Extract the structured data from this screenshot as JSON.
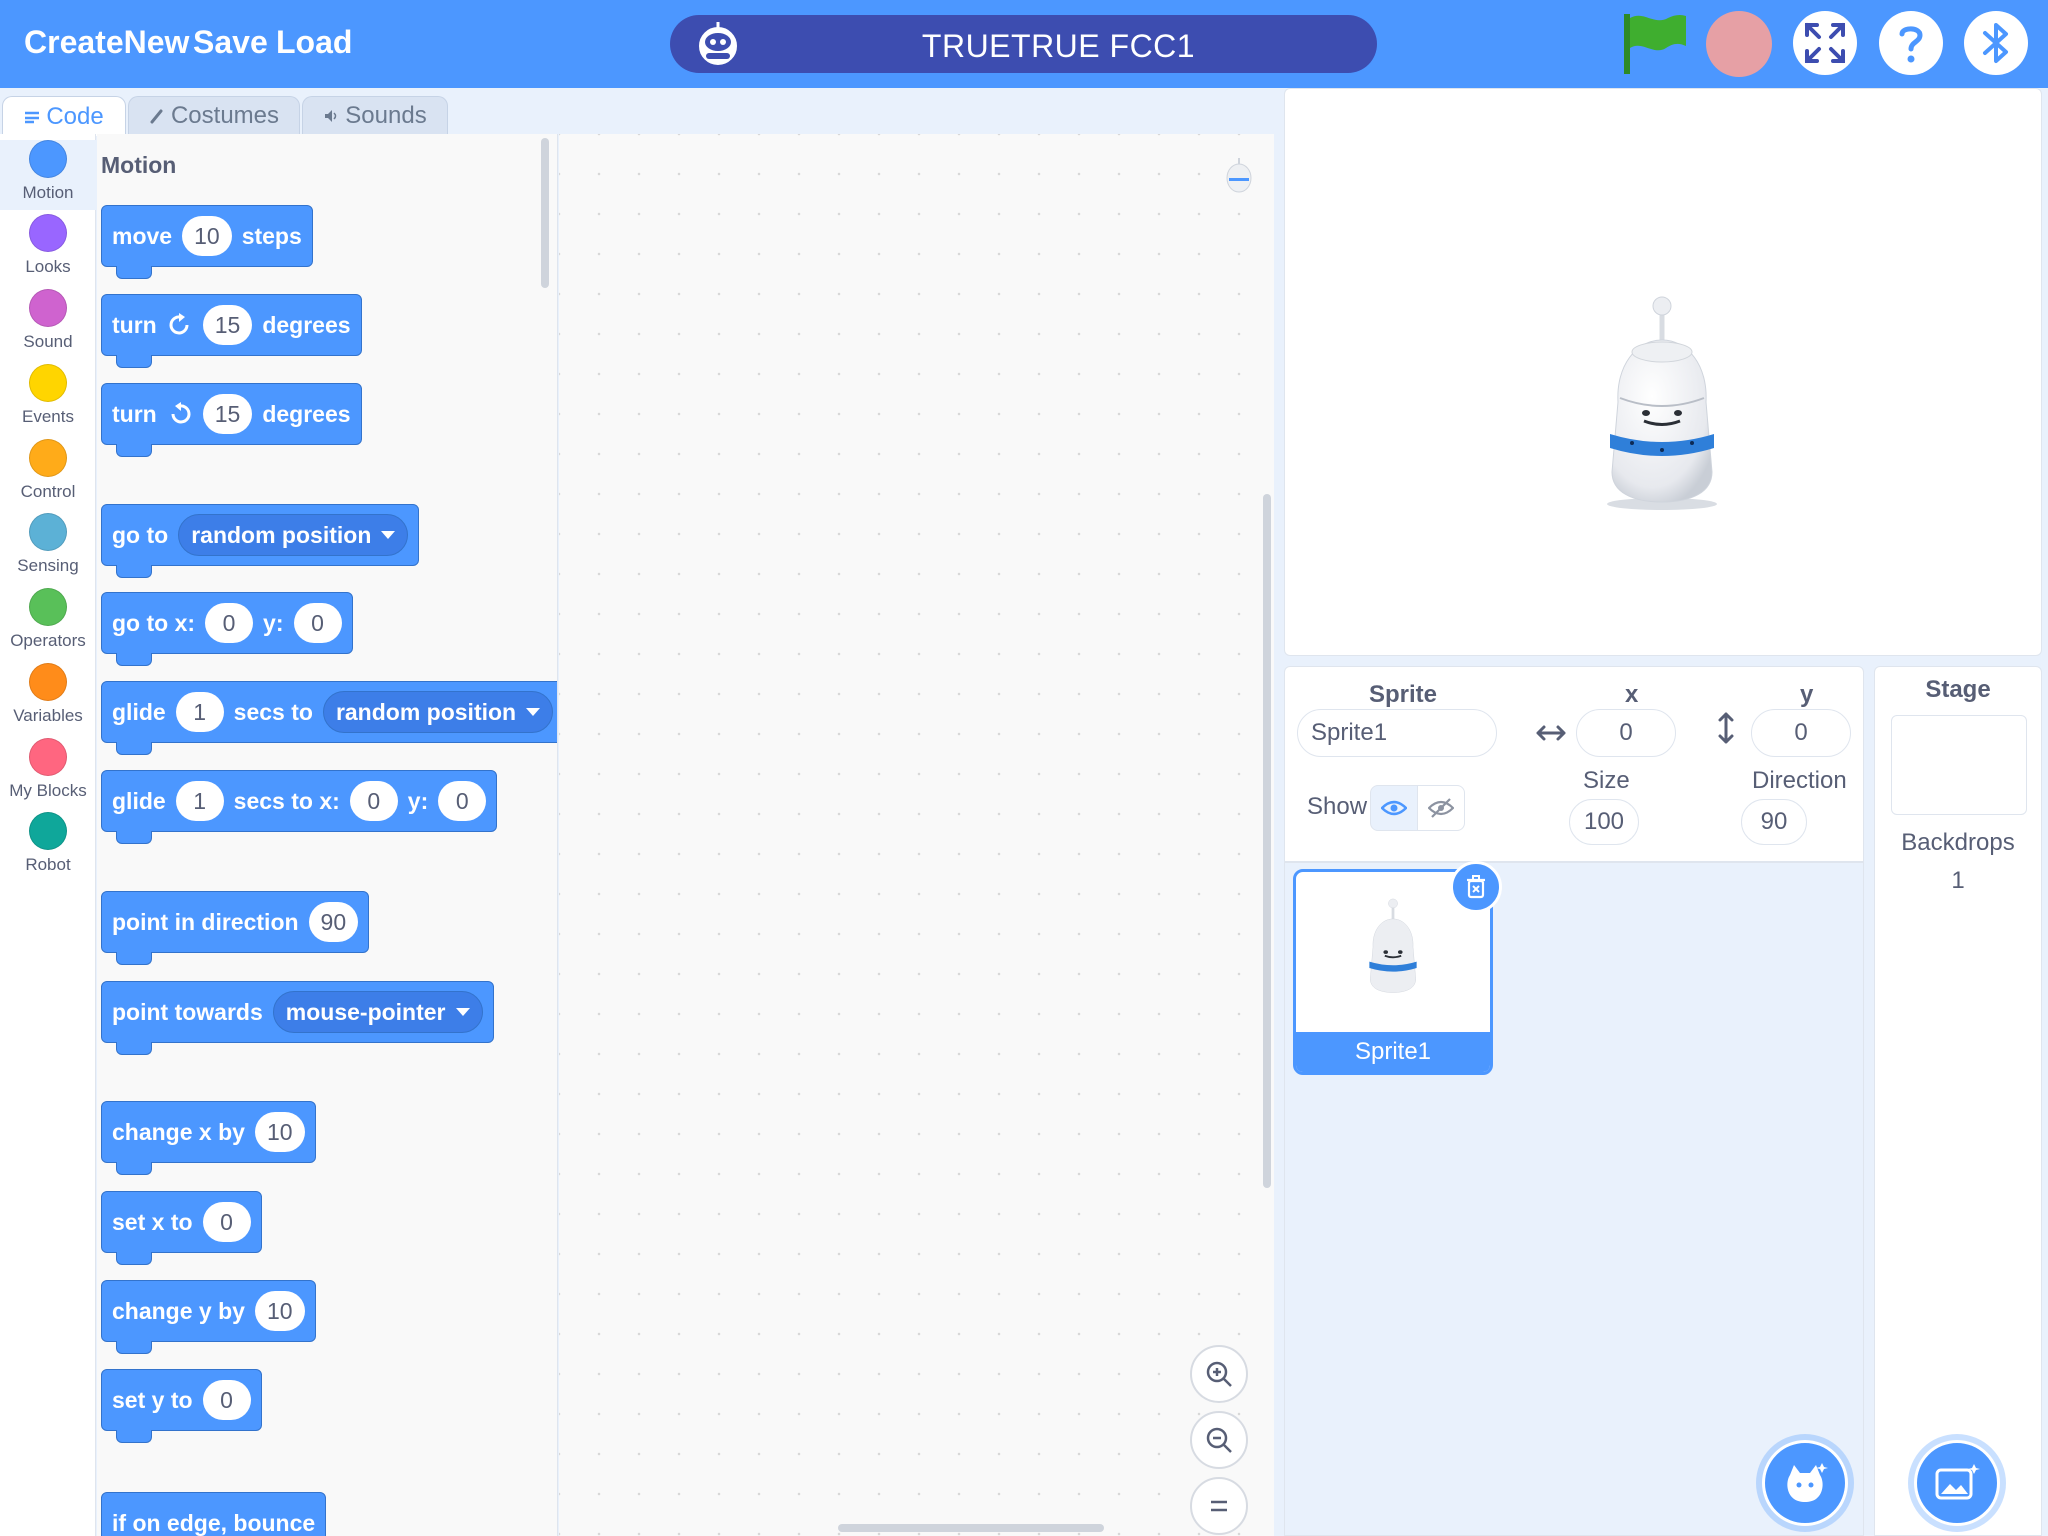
{
  "menu": {
    "create_new": "CreateNew",
    "save": "Save",
    "load": "Load"
  },
  "project": {
    "title": "TRUETRUE FCC1"
  },
  "colors": {
    "accent": "#4c97ff",
    "title_bar": "#3d4db0",
    "stop": "#e6a0a5",
    "flag": "#3fae2f"
  },
  "tabs": [
    {
      "label": "Code",
      "icon": "code-icon",
      "active": true
    },
    {
      "label": "Costumes",
      "icon": "brush-icon",
      "active": false
    },
    {
      "label": "Sounds",
      "icon": "speaker-icon",
      "active": false
    }
  ],
  "categories": [
    {
      "label": "Motion",
      "color": "#4c97ff"
    },
    {
      "label": "Looks",
      "color": "#9966ff"
    },
    {
      "label": "Sound",
      "color": "#cf63cf"
    },
    {
      "label": "Events",
      "color": "#ffd500"
    },
    {
      "label": "Control",
      "color": "#ffab19"
    },
    {
      "label": "Sensing",
      "color": "#5cb1d6"
    },
    {
      "label": "Operators",
      "color": "#59c059"
    },
    {
      "label": "Variables",
      "color": "#ff8c1a"
    },
    {
      "label": "My Blocks",
      "color": "#ff6680"
    },
    {
      "label": "Robot",
      "color": "#0fa79a"
    }
  ],
  "palette": {
    "title": "Motion",
    "blocks": {
      "move": {
        "w1": "move",
        "v1": "10",
        "w2": "steps"
      },
      "turn_cw": {
        "w1": "turn",
        "v1": "15",
        "w2": "degrees"
      },
      "turn_ccw": {
        "w1": "turn",
        "v1": "15",
        "w2": "degrees"
      },
      "go_to": {
        "w1": "go to",
        "d1": "random position"
      },
      "go_to_xy": {
        "w1": "go to x:",
        "v1": "0",
        "w2": "y:",
        "v2": "0"
      },
      "glide_to": {
        "w1": "glide",
        "v1": "1",
        "w2": "secs to",
        "d1": "random position"
      },
      "glide_xy": {
        "w1": "glide",
        "v1": "1",
        "w2": "secs to x:",
        "v2": "0",
        "w3": "y:",
        "v3": "0"
      },
      "point_dir": {
        "w1": "point in direction",
        "v1": "90"
      },
      "point_towards": {
        "w1": "point towards",
        "d1": "mouse-pointer"
      },
      "change_x": {
        "w1": "change x by",
        "v1": "10"
      },
      "set_x": {
        "w1": "set x to",
        "v1": "0"
      },
      "change_y": {
        "w1": "change y by",
        "v1": "10"
      },
      "set_y": {
        "w1": "set y to",
        "v1": "0"
      },
      "bounce": {
        "w1": "if on edge, bounce"
      }
    }
  },
  "sprite_info": {
    "sprite_label": "Sprite",
    "sprite_name": "Sprite1",
    "x_label": "x",
    "x_value": "0",
    "y_label": "y",
    "y_value": "0",
    "show_label": "Show",
    "size_label": "Size",
    "size_value": "100",
    "direction_label": "Direction",
    "direction_value": "90"
  },
  "sprites": [
    {
      "name": "Sprite1",
      "selected": true
    }
  ],
  "stage_panel": {
    "title": "Stage",
    "backdrops_label": "Backdrops",
    "backdrops_count": "1"
  }
}
